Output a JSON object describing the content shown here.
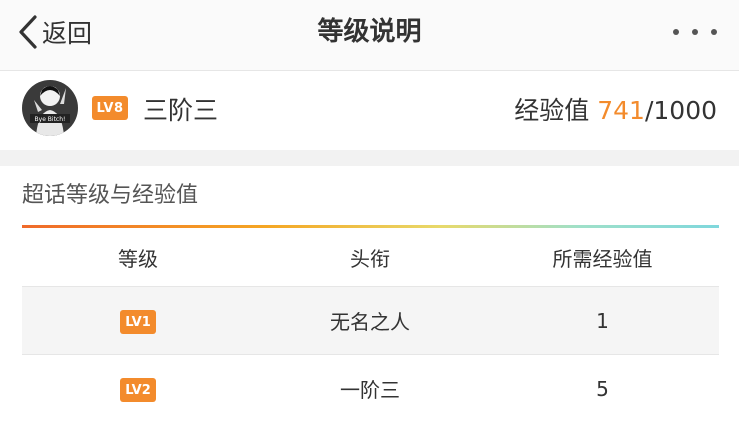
{
  "navbar": {
    "back_label": "返回",
    "title": "等级说明",
    "back_icon": "chevron-left-icon",
    "more_icon": "more-dots-icon"
  },
  "profile": {
    "avatar_text": "Bye Bitch!",
    "level_badge": "LV8",
    "level_name": "三阶三",
    "exp_label": "经验值",
    "exp_current": "741",
    "exp_total": "/1000"
  },
  "section": {
    "title": "超话等级与经验值"
  },
  "table": {
    "headers": [
      "等级",
      "头衔",
      "所需经验值"
    ],
    "rows": [
      {
        "badge": "LV1",
        "title": "无名之人",
        "exp": "1"
      },
      {
        "badge": "LV2",
        "title": "一阶三",
        "exp": "5"
      }
    ]
  },
  "colors": {
    "accent": "#f38b2c",
    "text": "#333333",
    "gap": "#f2f2f2",
    "row_alt": "#f5f5f5"
  }
}
